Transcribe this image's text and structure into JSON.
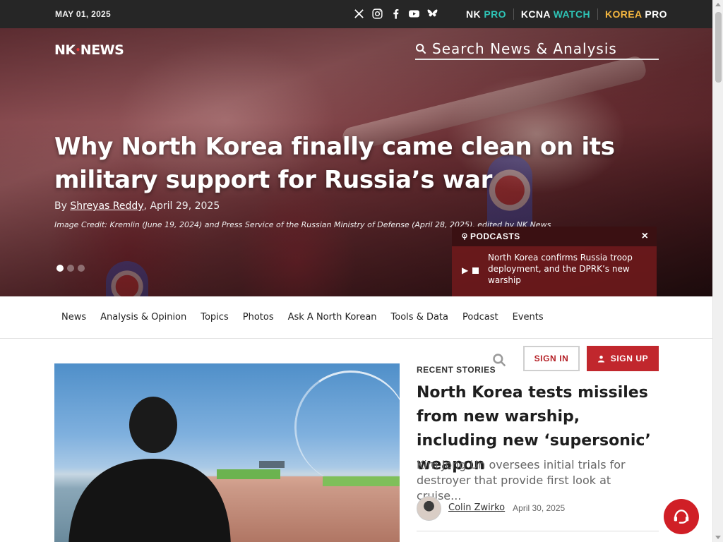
{
  "topbar": {
    "date": "MAY 01, 2025",
    "social": [
      "x-icon",
      "instagram-icon",
      "facebook-icon",
      "youtube-icon",
      "bluesky-icon"
    ],
    "products": [
      {
        "first": "NK",
        "second": "PRO",
        "second_color": "#2ec4b6"
      },
      {
        "first": "KCNA",
        "second": "WATCH",
        "second_color": "#2ec4b6"
      },
      {
        "first": "KOREA",
        "second": "PRO",
        "first_color": "#f4b63f"
      }
    ]
  },
  "header": {
    "logo_left": "NK",
    "logo_right": "NEWS",
    "search_placeholder": "Search News & Analysis"
  },
  "hero": {
    "headline": "Why North Korea finally came clean on its military support for Russia’s war",
    "by": "By",
    "author": "Shreyas Reddy",
    "date": ", April 29, 2025",
    "credit": "Image Credit: Kremlin (June 19, 2024) and Press Service of the Russian Ministry of Defense (April 28, 2025), edited by NK News",
    "slide_count": 3,
    "active_slide": 1
  },
  "podcast": {
    "label": "PODCASTS",
    "close": "×",
    "title": "North Korea confirms Russia troop deployment, and the DPRK’s new warship"
  },
  "nav": {
    "items": [
      "News",
      "Analysis & Opinion",
      "Topics",
      "Photos",
      "Ask A North Korean",
      "Tools & Data",
      "Podcast",
      "Events"
    ]
  },
  "account": {
    "sign_in": "SIGN IN",
    "sign_up": "SIGN UP"
  },
  "recent": {
    "label": "RECENT STORIES",
    "title": "North Korea tests missiles from new warship, including new ‘supersonic’ weapon",
    "summary": "Kim Jong Un oversees initial trials for destroyer that provide first look at cruise...",
    "author": "Colin Zwirko",
    "date": "April 30, 2025"
  },
  "colors": {
    "accent": "#c1272d",
    "topbar": "#262626",
    "teal": "#2ec4b6",
    "gold": "#f4b63f"
  }
}
